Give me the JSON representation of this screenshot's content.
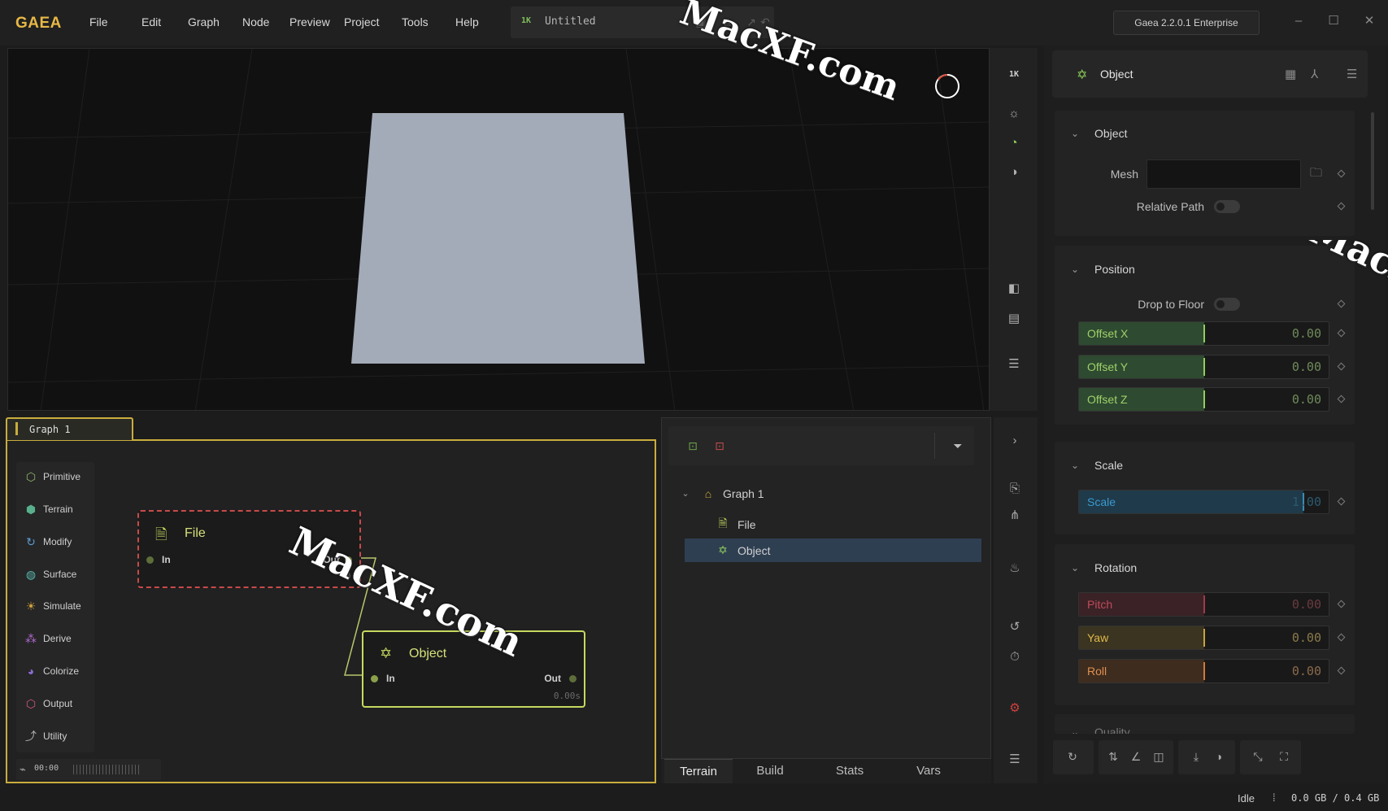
{
  "app": {
    "logo": "GAEA",
    "version": "Gaea 2.2.0.1 Enterprise"
  },
  "menu": [
    "File",
    "Edit",
    "Graph",
    "Node",
    "Preview",
    "Project",
    "Tools",
    "Help"
  ],
  "document": {
    "resolution": "1K",
    "title": "Untitled"
  },
  "viewport": {
    "resolution_label": "1K",
    "tools": [
      "1k-resolution-toggle",
      "sun-icon",
      "shading-icon",
      "material-icon",
      "compare-icon",
      "ruler-icon",
      "menu-icon"
    ],
    "plane_color": "#a3abb8"
  },
  "graph": {
    "tab_label": "Graph 1",
    "palette": [
      {
        "label": "Primitive",
        "icon": "cube-icon",
        "color": "#8fb86a"
      },
      {
        "label": "Terrain",
        "icon": "mountain-icon",
        "color": "#58b08c"
      },
      {
        "label": "Modify",
        "icon": "modify-icon",
        "color": "#5a9ad0"
      },
      {
        "label": "Surface",
        "icon": "surface-icon",
        "color": "#5ab7b0"
      },
      {
        "label": "Simulate",
        "icon": "simulate-icon",
        "color": "#d0a040"
      },
      {
        "label": "Derive",
        "icon": "derive-icon",
        "color": "#b06ad0"
      },
      {
        "label": "Colorize",
        "icon": "palette-icon",
        "color": "#8a6ad0"
      },
      {
        "label": "Output",
        "icon": "output-icon",
        "color": "#d05a7a"
      },
      {
        "label": "Utility",
        "icon": "utility-icon",
        "color": "#b0b0b0"
      }
    ],
    "time": "00:00",
    "nodes": {
      "file": {
        "title": "File",
        "in": "In",
        "out": "Out",
        "time": "0."
      },
      "object": {
        "title": "Object",
        "in": "In",
        "out": "Out",
        "time": "0.00s"
      }
    }
  },
  "tree": {
    "root": "Graph 1",
    "children": [
      "File",
      "Object"
    ],
    "selected": "Object"
  },
  "bottom_tabs": [
    "Terrain",
    "Build",
    "Stats",
    "Vars"
  ],
  "props": {
    "title": "Object",
    "sections": {
      "object": {
        "title": "Object",
        "mesh_label": "Mesh",
        "mesh_value": "",
        "relative_path_label": "Relative Path",
        "relative_path": false
      },
      "position": {
        "title": "Position",
        "drop_to_floor_label": "Drop to Floor",
        "drop_to_floor": false,
        "offsets": [
          {
            "label": "Offset X",
            "value": "0.00",
            "fraction": 0.5
          },
          {
            "label": "Offset Y",
            "value": "0.00",
            "fraction": 0.5
          },
          {
            "label": "Offset Z",
            "value": "0.00",
            "fraction": 0.5
          }
        ]
      },
      "scale": {
        "title": "Scale",
        "label": "Scale",
        "value": "1.00",
        "fraction": 0.9
      },
      "rotation": {
        "title": "Rotation",
        "items": [
          {
            "label": "Pitch",
            "value": "0.00",
            "fraction": 0.5
          },
          {
            "label": "Yaw",
            "value": "0.00",
            "fraction": 0.5
          },
          {
            "label": "Roll",
            "value": "0.00",
            "fraction": 0.5
          }
        ]
      },
      "quality": {
        "title": "Quality"
      }
    }
  },
  "status": {
    "state": "Idle",
    "memory": "0.0 GB / 0.4 GB"
  },
  "watermark": "MacXF.com"
}
